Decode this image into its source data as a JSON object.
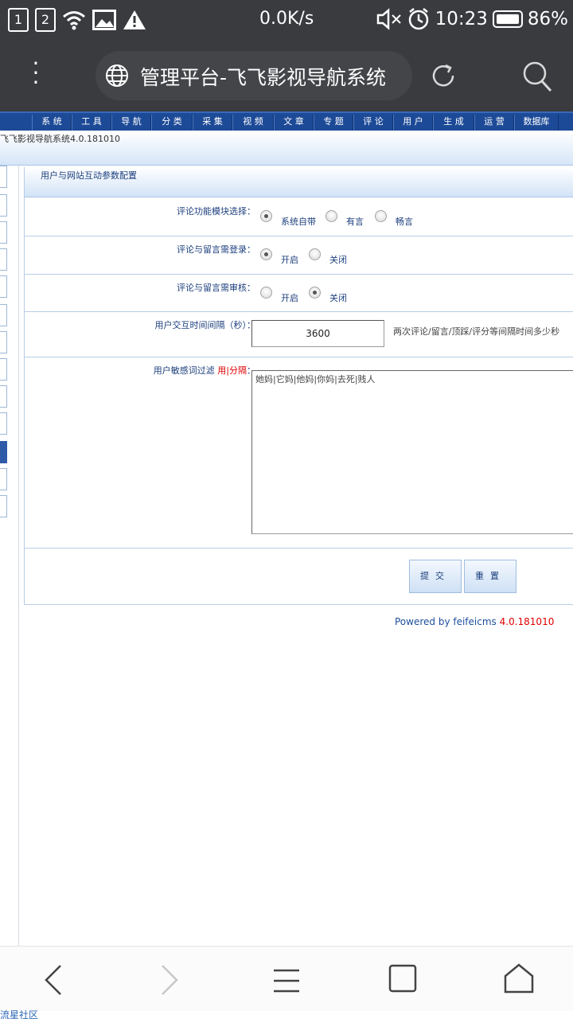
{
  "status_bar": {
    "sim1": "1",
    "sim2": "2",
    "net_speed": "0.0K/s",
    "time": "10:23",
    "battery": "86%",
    "icons": [
      "sim-1-icon",
      "sim-2-icon",
      "wifi-icon",
      "image-icon",
      "warning-icon",
      "mute-icon",
      "alarm-icon",
      "battery-icon"
    ]
  },
  "browser": {
    "page_title": "管理平台-飞飞影视导航系统"
  },
  "nav": {
    "items": [
      "系 统",
      "工 具",
      "导 航",
      "分 类",
      "采 集",
      "视 频",
      "文 章",
      "专 题",
      "评 论",
      "用 户",
      "生 成",
      "运 营",
      "数据库"
    ]
  },
  "version_text": "飞飞影视导航系统4.0.181010",
  "panel": {
    "title": "用户与网站互动参数配置",
    "rows": {
      "module": {
        "label": "评论功能模块选择：",
        "options": [
          "系统自带",
          "有言",
          "畅言"
        ],
        "selected": 0
      },
      "login": {
        "label": "评论与留言需登录：",
        "options": [
          "开启",
          "关闭"
        ],
        "selected": 0
      },
      "review": {
        "label": "评论与留言需审核：",
        "options": [
          "开启",
          "关闭"
        ],
        "selected": 1
      },
      "interval": {
        "label": "用户交互时间间隔（秒）：",
        "value": "3600",
        "hint": "两次评论/留言/顶踩/评分等间隔时间多少秒"
      },
      "filter": {
        "label_prefix": "用户敏感词过滤",
        "label_red": "用|分隔",
        "label_suffix": "：",
        "value": "她妈|它妈|他妈|你妈|去死|贱人"
      }
    },
    "submit_label": "提交",
    "reset_label": "重置"
  },
  "footer": {
    "powered": "Powered by feifeicms",
    "version": "4.0.181010"
  },
  "bottom_text": "流星社区",
  "colors": {
    "nav_bg": "#1d4a97",
    "label_blue": "#1c3f7d",
    "accent_red": "#e00000",
    "status_bg": "#393b3f"
  }
}
